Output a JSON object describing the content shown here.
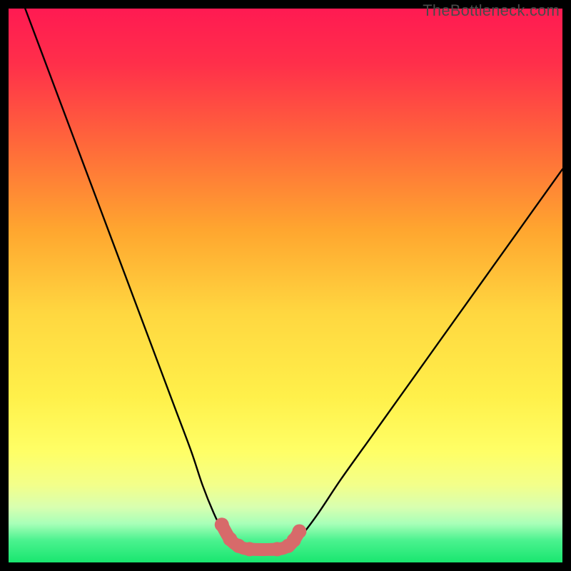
{
  "watermark": "TheBottleneck.com",
  "chart_data": {
    "type": "line",
    "title": "",
    "xlabel": "",
    "ylabel": "",
    "xlim": [
      0,
      100
    ],
    "ylim": [
      0,
      100
    ],
    "series": [
      {
        "name": "curve-left",
        "x": [
          3,
          6,
          9,
          12,
          15,
          18,
          21,
          24,
          27,
          30,
          33,
          35,
          37,
          38.5,
          40,
          41
        ],
        "y": [
          100,
          92,
          84,
          76,
          68,
          60,
          52,
          44,
          36,
          28,
          20,
          14,
          9,
          6,
          4,
          3
        ]
      },
      {
        "name": "flat-bottom",
        "x": [
          41,
          43,
          45,
          47,
          49,
          51
        ],
        "y": [
          3,
          2.3,
          2.1,
          2.1,
          2.3,
          3
        ]
      },
      {
        "name": "curve-right",
        "x": [
          51,
          53,
          56,
          60,
          65,
          70,
          75,
          80,
          85,
          90,
          95,
          100
        ],
        "y": [
          3,
          5,
          9,
          15,
          22,
          29,
          36,
          43,
          50,
          57,
          64,
          71
        ]
      }
    ],
    "markers": {
      "name": "valley-dots",
      "x": [
        38.5,
        40,
        41.5,
        43.5,
        48.5,
        50.5,
        51.5,
        52.5
      ],
      "y": [
        6.8,
        4.2,
        3.0,
        2.4,
        2.4,
        3.0,
        4.0,
        5.6
      ]
    },
    "gradient_stops": [
      {
        "offset": 0.0,
        "color": "#ff1a52"
      },
      {
        "offset": 0.1,
        "color": "#ff2f4a"
      },
      {
        "offset": 0.25,
        "color": "#ff6a3a"
      },
      {
        "offset": 0.4,
        "color": "#ffa62f"
      },
      {
        "offset": 0.55,
        "color": "#ffd740"
      },
      {
        "offset": 0.7,
        "color": "#fff04a"
      },
      {
        "offset": 0.8,
        "color": "#ffff66"
      },
      {
        "offset": 0.86,
        "color": "#f3ff8a"
      },
      {
        "offset": 0.9,
        "color": "#d8ffb0"
      },
      {
        "offset": 0.93,
        "color": "#a8ffb8"
      },
      {
        "offset": 0.96,
        "color": "#4bf28f"
      },
      {
        "offset": 1.0,
        "color": "#19e66f"
      }
    ],
    "curve_color": "#000000",
    "marker_color": "#d76a6a",
    "marker_radius": 10
  }
}
